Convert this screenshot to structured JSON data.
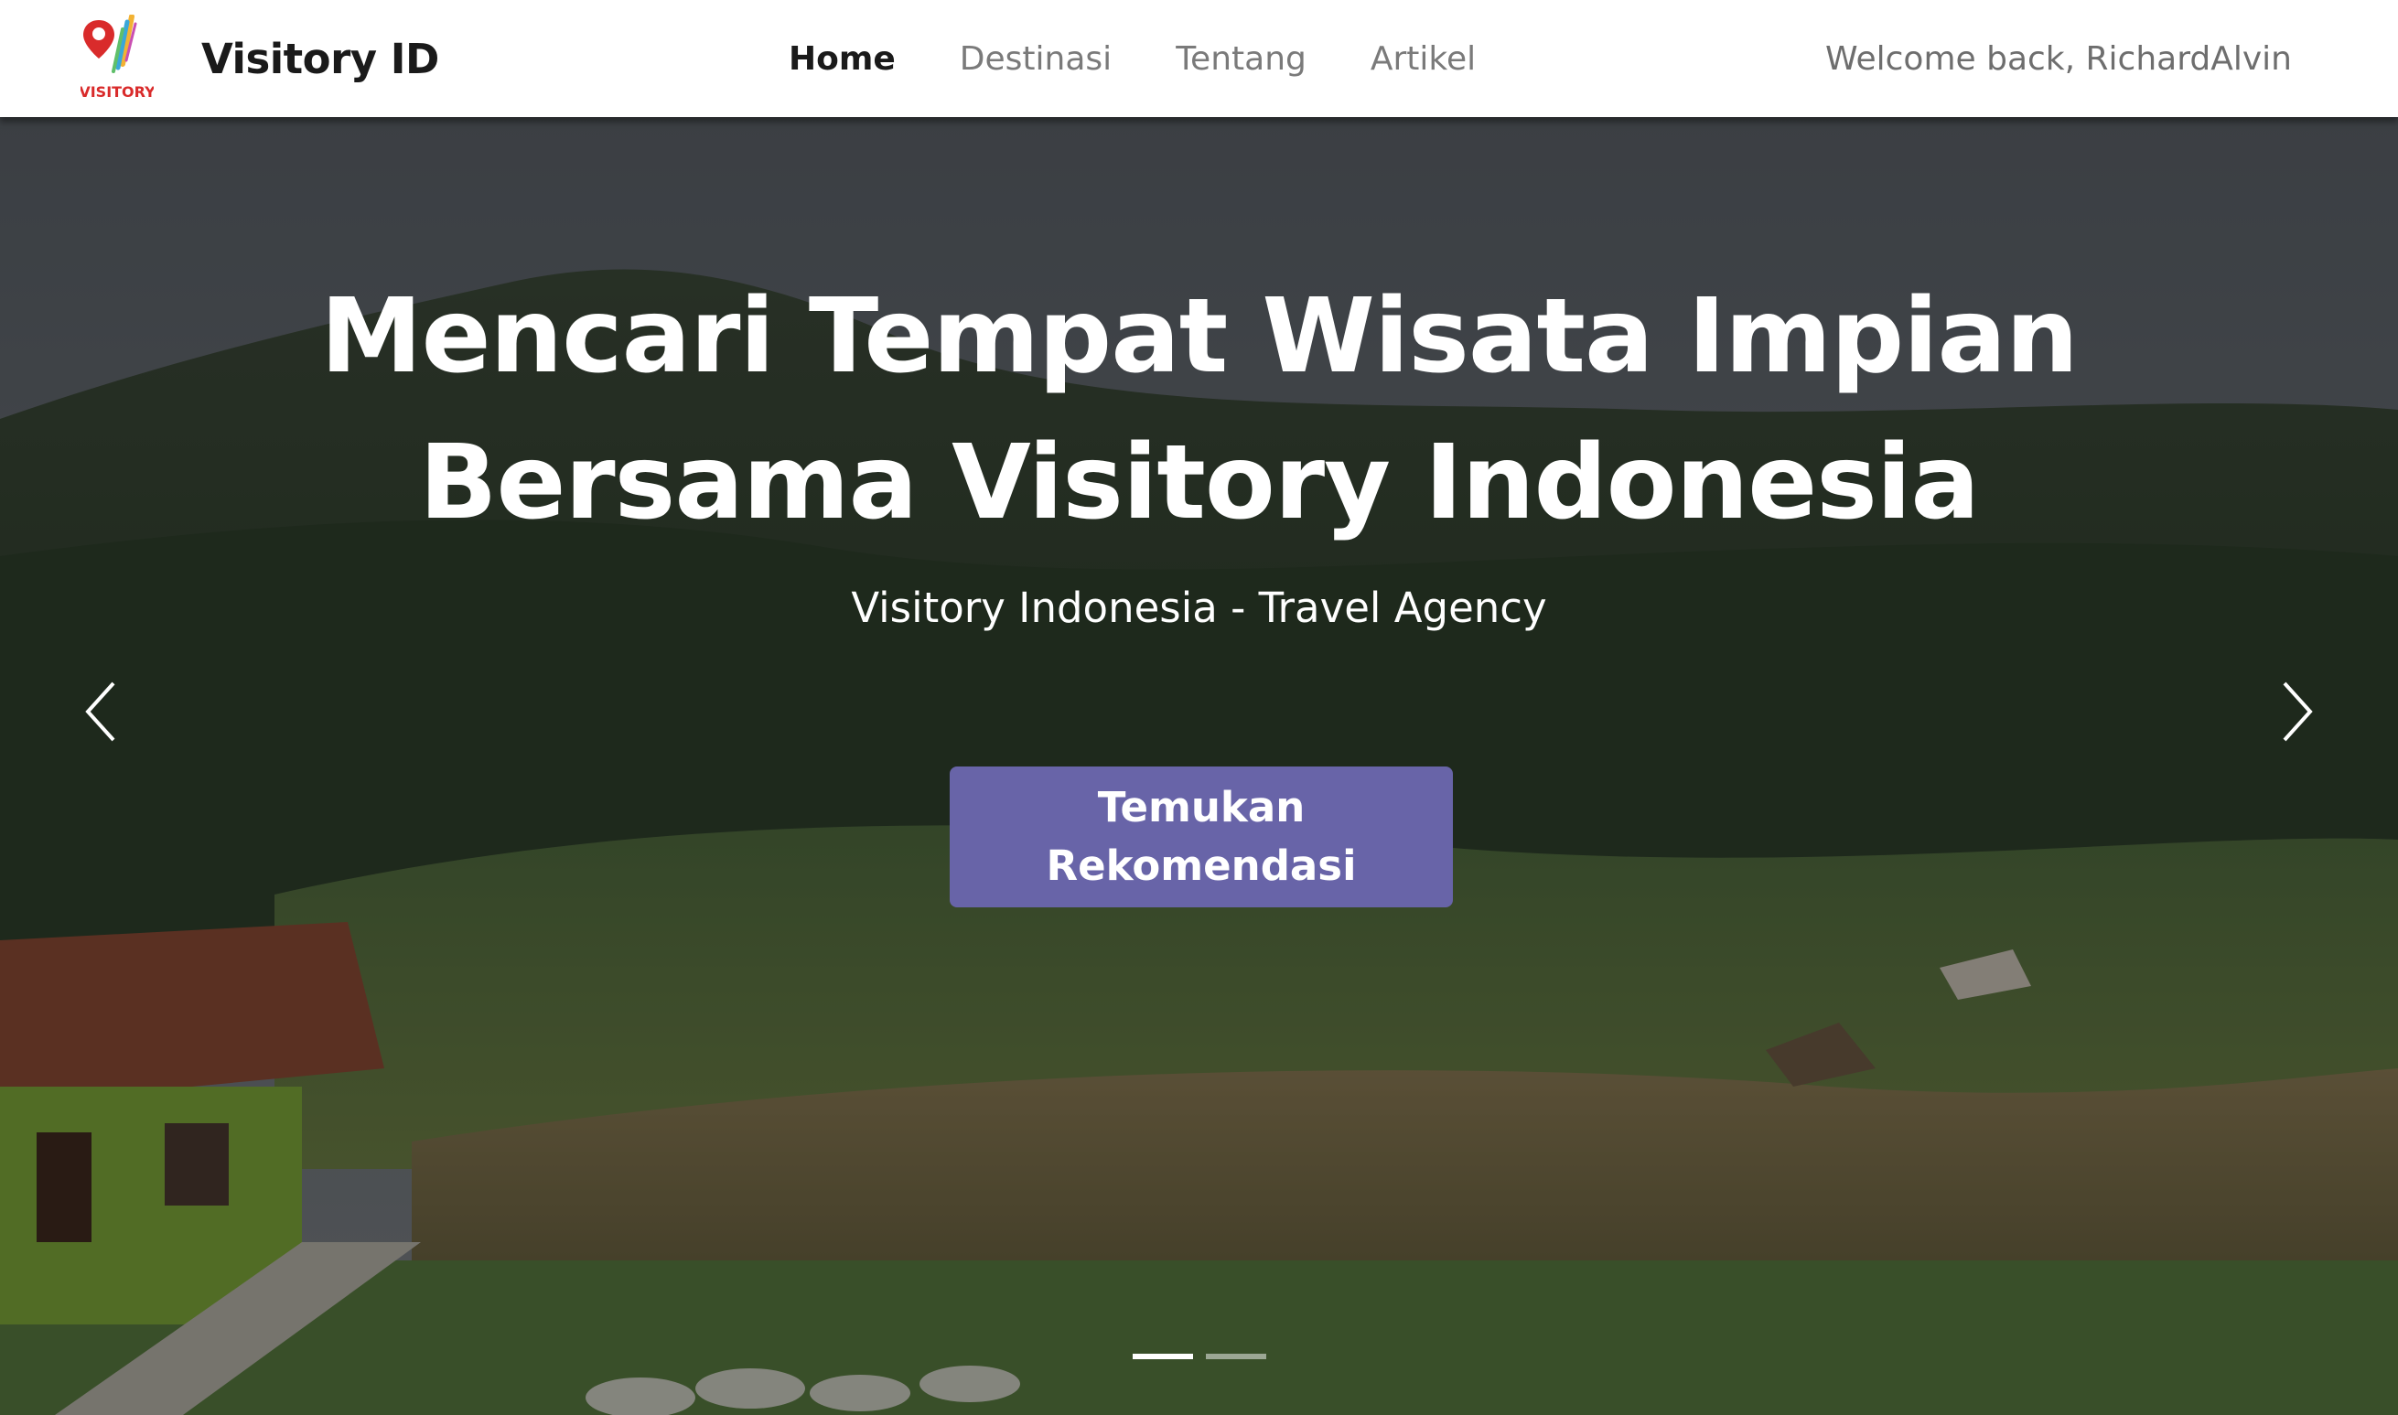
{
  "brand": {
    "name": "Visitory ID",
    "logo_text": "VISITORY"
  },
  "nav": {
    "items": [
      {
        "label": "Home",
        "active": true
      },
      {
        "label": "Destinasi",
        "active": false
      },
      {
        "label": "Tentang",
        "active": false
      },
      {
        "label": "Artikel",
        "active": false
      }
    ],
    "welcome": "Welcome back, RichardAlvin"
  },
  "hero": {
    "title_line1": "Mencari Tempat Wisata Impian",
    "title_line2": "Bersama Visitory Indonesia",
    "subtitle": "Visitory Indonesia - Travel Agency",
    "cta_line1": "Temukan",
    "cta_line2": "Rekomendasi",
    "slide_count": 2,
    "active_slide": 1
  },
  "icons": {
    "prev": "chevron-left-icon",
    "next": "chevron-right-icon",
    "logo": "map-pin-logo-icon"
  },
  "colors": {
    "cta": "#6864a8",
    "nav_active": "#1a1a1a",
    "nav_inactive": "#7a7a7a",
    "logo_red": "#d92b2b"
  }
}
